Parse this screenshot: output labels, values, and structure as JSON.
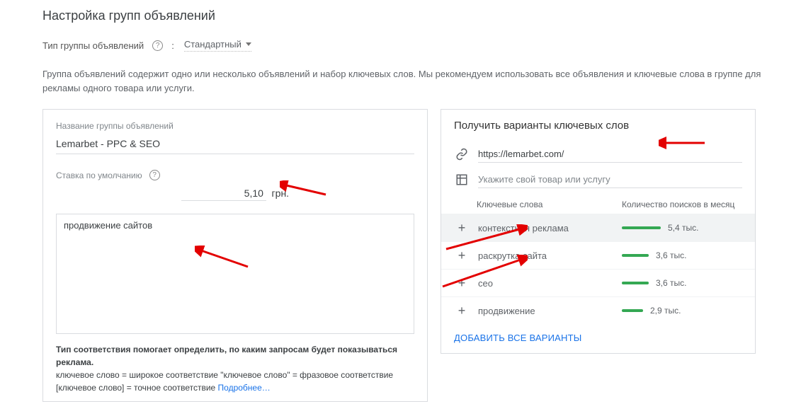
{
  "header": "Настройка групп объявлений",
  "type_row": {
    "label": "Тип группы объявлений",
    "value": "Стандартный"
  },
  "description": "Группа объявлений содержит одно или несколько объявлений и набор ключевых слов. Мы рекомендуем использовать все объявления и ключевые слова в группе для рекламы одного товара или услуги.",
  "left": {
    "group_name_label": "Название группы объявлений",
    "group_name_value": "Lemarbet - PPC & SEO",
    "bid_label": "Ставка по умолчанию",
    "bid_value": "5,10",
    "bid_currency": "грн.",
    "keywords_value": "продвижение сайтов",
    "match_title": "Тип соответствия помогает определить, по каким запросам будет показываться реклама.",
    "match_line": "ключевое слово = широкое соответствие   \"ключевое слово\" = фразовое соответствие   [ключевое слово] = точное соответствие   ",
    "more_link": "Подробнее…"
  },
  "right": {
    "title": "Получить варианты ключевых слов",
    "url_value": "https://lemarbet.com/",
    "product_placeholder": "Укажите свой товар или услугу",
    "col_kw": "Ключевые слова",
    "col_vol": "Количество поисков в месяц",
    "rows": [
      {
        "kw": "контекстная реклама",
        "vol": "5,4 тыс.",
        "bar": 55,
        "selected": true
      },
      {
        "kw": "раскрутка сайта",
        "vol": "3,6 тыс.",
        "bar": 38,
        "selected": false
      },
      {
        "kw": "сео",
        "vol": "3,6 тыс.",
        "bar": 38,
        "selected": false
      },
      {
        "kw": "продвижение",
        "vol": "2,9 тыс.",
        "bar": 30,
        "selected": false
      }
    ],
    "add_all": "ДОБАВИТЬ ВСЕ ВАРИАНТЫ"
  }
}
